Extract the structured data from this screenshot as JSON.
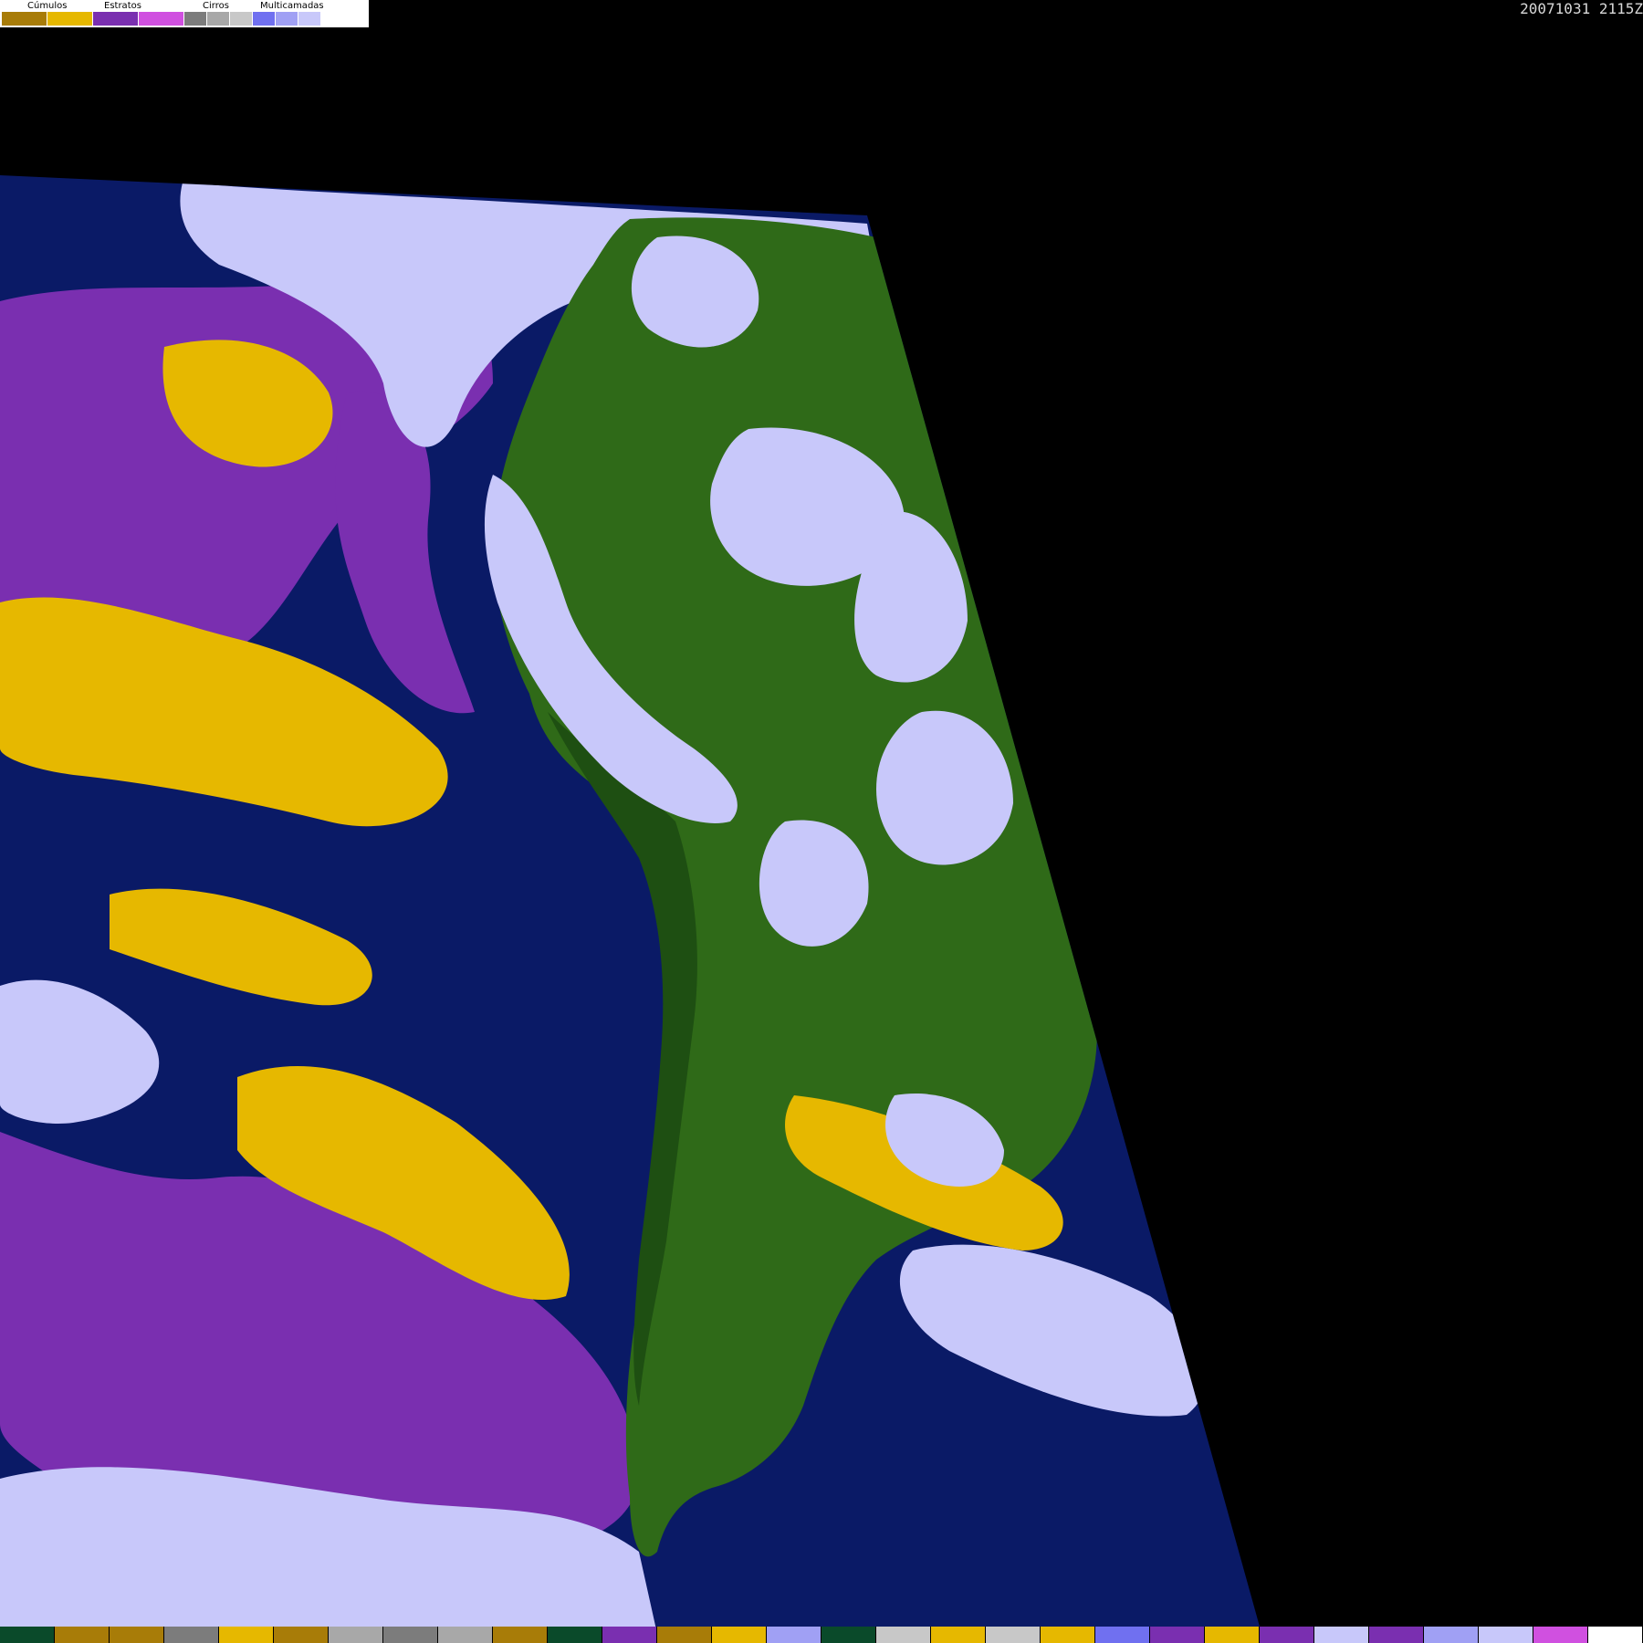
{
  "timestamp": "20071031 2115Z",
  "legend": {
    "groups": [
      {
        "label": "Cúmulos",
        "colors": [
          "#a87c08",
          "#e6b800"
        ]
      },
      {
        "label": "Estratos",
        "colors": [
          "#7a2fb0",
          "#d050e0"
        ]
      },
      {
        "label": "Cirros",
        "colors": [
          "#7c7c7c",
          "#a8a8a8",
          "#c8c8c8"
        ]
      },
      {
        "label": "Multicamadas",
        "colors": [
          "#7070f0",
          "#a0a0f4",
          "#c8c8fa",
          "#ffffff"
        ]
      }
    ]
  },
  "map_colors": {
    "ocean": "#0a1a66",
    "land": "#2f6a18",
    "land_dark": "#1e4f12",
    "cumulus": "#e6b800",
    "stratus": "#7a2fb0",
    "multilayer": "#c8c8fa",
    "cirrus": "#a8a8a8"
  },
  "bottom_strip": [
    "#0a4a2a",
    "#a87c08",
    "#a87c08",
    "#7c7c7c",
    "#e6b800",
    "#a87c08",
    "#a8a8a8",
    "#7c7c7c",
    "#a8a8a8",
    "#a87c08",
    "#0a4a2a",
    "#7a2fb0",
    "#a87c08",
    "#e6b800",
    "#a0a0f4",
    "#0a4a2a",
    "#c8c8c8",
    "#e6b800",
    "#c8c8c8",
    "#e6b800",
    "#7070f0",
    "#7a2fb0",
    "#e6b800",
    "#7a2fb0",
    "#c8c8fa",
    "#7a2fb0",
    "#a0a0f4",
    "#c8c8fa",
    "#d050e0",
    "#ffffff"
  ]
}
